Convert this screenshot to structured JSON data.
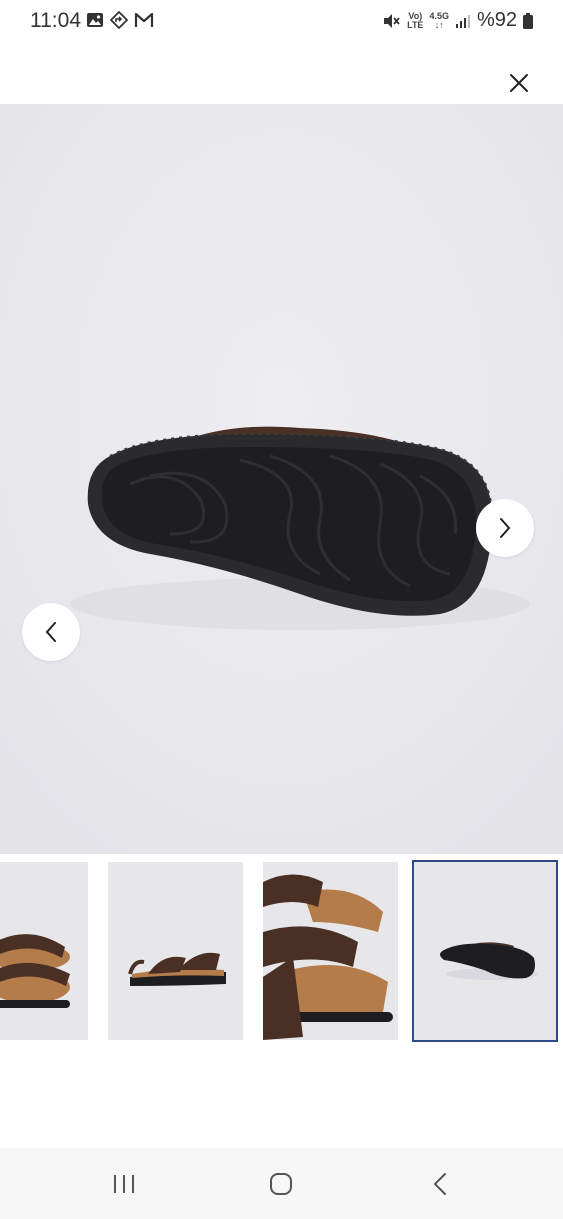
{
  "status_bar": {
    "time": "11:04",
    "left_icons": [
      "gallery-icon",
      "navigation-icon",
      "gmail-icon"
    ],
    "network_top": "Vo)",
    "network_bottom": "LTE",
    "data_top": "4.5G",
    "data_bottom": "↓↑",
    "battery_text": "%92",
    "right_icons": [
      "mute-icon",
      "signal-icon",
      "battery-icon"
    ]
  },
  "header": {
    "close_icon": "close-icon"
  },
  "gallery": {
    "prev_icon": "chevron-left-icon",
    "next_icon": "chevron-right-icon",
    "active_index": 4,
    "thumbnail_count": 4,
    "colors": {
      "background": "#e9e9ee",
      "active_border": "#2c4a8a",
      "sole": "#1e1e20",
      "leather": "#4a3024",
      "footbed": "#b37c4a"
    }
  },
  "system_nav": {
    "recents_icon": "recents-icon",
    "home_icon": "home-icon",
    "back_icon": "back-icon"
  }
}
